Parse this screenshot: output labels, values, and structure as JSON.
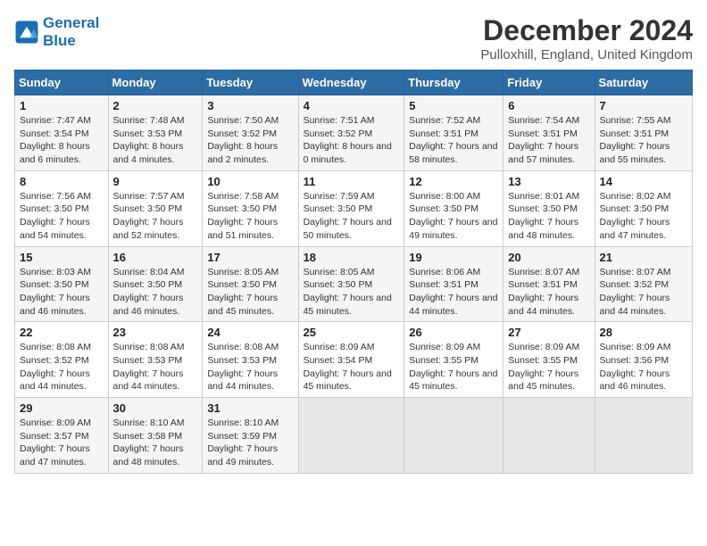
{
  "logo": {
    "line1": "General",
    "line2": "Blue"
  },
  "title": "December 2024",
  "subtitle": "Pulloxhill, England, United Kingdom",
  "days_header": [
    "Sunday",
    "Monday",
    "Tuesday",
    "Wednesday",
    "Thursday",
    "Friday",
    "Saturday"
  ],
  "weeks": [
    [
      {
        "num": "1",
        "rise": "7:47 AM",
        "set": "3:54 PM",
        "daylight": "8 hours and 6 minutes."
      },
      {
        "num": "2",
        "rise": "7:48 AM",
        "set": "3:53 PM",
        "daylight": "8 hours and 4 minutes."
      },
      {
        "num": "3",
        "rise": "7:50 AM",
        "set": "3:52 PM",
        "daylight": "8 hours and 2 minutes."
      },
      {
        "num": "4",
        "rise": "7:51 AM",
        "set": "3:52 PM",
        "daylight": "8 hours and 0 minutes."
      },
      {
        "num": "5",
        "rise": "7:52 AM",
        "set": "3:51 PM",
        "daylight": "7 hours and 58 minutes."
      },
      {
        "num": "6",
        "rise": "7:54 AM",
        "set": "3:51 PM",
        "daylight": "7 hours and 57 minutes."
      },
      {
        "num": "7",
        "rise": "7:55 AM",
        "set": "3:51 PM",
        "daylight": "7 hours and 55 minutes."
      }
    ],
    [
      {
        "num": "8",
        "rise": "7:56 AM",
        "set": "3:50 PM",
        "daylight": "7 hours and 54 minutes."
      },
      {
        "num": "9",
        "rise": "7:57 AM",
        "set": "3:50 PM",
        "daylight": "7 hours and 52 minutes."
      },
      {
        "num": "10",
        "rise": "7:58 AM",
        "set": "3:50 PM",
        "daylight": "7 hours and 51 minutes."
      },
      {
        "num": "11",
        "rise": "7:59 AM",
        "set": "3:50 PM",
        "daylight": "7 hours and 50 minutes."
      },
      {
        "num": "12",
        "rise": "8:00 AM",
        "set": "3:50 PM",
        "daylight": "7 hours and 49 minutes."
      },
      {
        "num": "13",
        "rise": "8:01 AM",
        "set": "3:50 PM",
        "daylight": "7 hours and 48 minutes."
      },
      {
        "num": "14",
        "rise": "8:02 AM",
        "set": "3:50 PM",
        "daylight": "7 hours and 47 minutes."
      }
    ],
    [
      {
        "num": "15",
        "rise": "8:03 AM",
        "set": "3:50 PM",
        "daylight": "7 hours and 46 minutes."
      },
      {
        "num": "16",
        "rise": "8:04 AM",
        "set": "3:50 PM",
        "daylight": "7 hours and 46 minutes."
      },
      {
        "num": "17",
        "rise": "8:05 AM",
        "set": "3:50 PM",
        "daylight": "7 hours and 45 minutes."
      },
      {
        "num": "18",
        "rise": "8:05 AM",
        "set": "3:50 PM",
        "daylight": "7 hours and 45 minutes."
      },
      {
        "num": "19",
        "rise": "8:06 AM",
        "set": "3:51 PM",
        "daylight": "7 hours and 44 minutes."
      },
      {
        "num": "20",
        "rise": "8:07 AM",
        "set": "3:51 PM",
        "daylight": "7 hours and 44 minutes."
      },
      {
        "num": "21",
        "rise": "8:07 AM",
        "set": "3:52 PM",
        "daylight": "7 hours and 44 minutes."
      }
    ],
    [
      {
        "num": "22",
        "rise": "8:08 AM",
        "set": "3:52 PM",
        "daylight": "7 hours and 44 minutes."
      },
      {
        "num": "23",
        "rise": "8:08 AM",
        "set": "3:53 PM",
        "daylight": "7 hours and 44 minutes."
      },
      {
        "num": "24",
        "rise": "8:08 AM",
        "set": "3:53 PM",
        "daylight": "7 hours and 44 minutes."
      },
      {
        "num": "25",
        "rise": "8:09 AM",
        "set": "3:54 PM",
        "daylight": "7 hours and 45 minutes."
      },
      {
        "num": "26",
        "rise": "8:09 AM",
        "set": "3:55 PM",
        "daylight": "7 hours and 45 minutes."
      },
      {
        "num": "27",
        "rise": "8:09 AM",
        "set": "3:55 PM",
        "daylight": "7 hours and 45 minutes."
      },
      {
        "num": "28",
        "rise": "8:09 AM",
        "set": "3:56 PM",
        "daylight": "7 hours and 46 minutes."
      }
    ],
    [
      {
        "num": "29",
        "rise": "8:09 AM",
        "set": "3:57 PM",
        "daylight": "7 hours and 47 minutes."
      },
      {
        "num": "30",
        "rise": "8:10 AM",
        "set": "3:58 PM",
        "daylight": "7 hours and 48 minutes."
      },
      {
        "num": "31",
        "rise": "8:10 AM",
        "set": "3:59 PM",
        "daylight": "7 hours and 49 minutes."
      },
      null,
      null,
      null,
      null
    ]
  ],
  "labels": {
    "sunrise": "Sunrise:",
    "sunset": "Sunset:",
    "daylight": "Daylight:"
  }
}
